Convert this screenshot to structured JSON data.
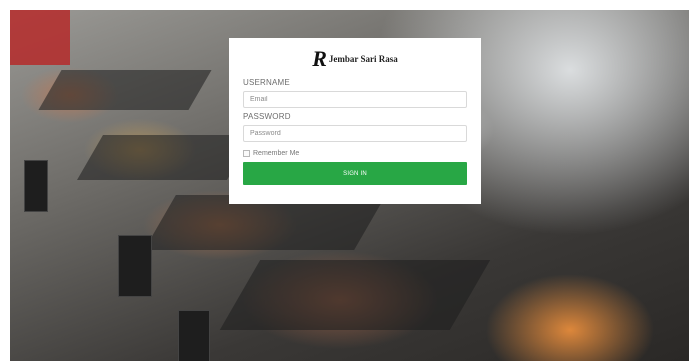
{
  "brand": {
    "logo_glyph": "R",
    "name": "Jembar Sari Rasa"
  },
  "form": {
    "username_label": "USERNAME",
    "username_placeholder": "Email",
    "password_label": "PASSWORD",
    "password_placeholder": "Password",
    "remember_label": "Remember Me",
    "remember_checked": false,
    "submit_label": "SIGN IN"
  },
  "colors": {
    "submit_bg": "#28a745",
    "card_bg": "#ffffff"
  }
}
